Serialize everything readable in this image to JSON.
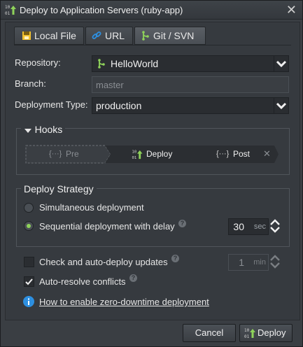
{
  "window": {
    "title": "Deploy to Application Servers (ruby-app)"
  },
  "tabs": [
    {
      "label": "Local File",
      "icon": "archive-icon"
    },
    {
      "label": "URL",
      "icon": "link-icon"
    },
    {
      "label": "Git / SVN",
      "icon": "git-icon",
      "active": true
    }
  ],
  "form": {
    "repository_label": "Repository:",
    "repository_value": "HelloWorld",
    "branch_label": "Branch:",
    "branch_value": "master",
    "deploy_type_label": "Deployment Type:",
    "deploy_type_value": "production"
  },
  "hooks": {
    "title": "Hooks",
    "pre": "Pre",
    "deploy": "Deploy",
    "post": "Post",
    "code_glyph": "{···}"
  },
  "strategy": {
    "title": "Deploy Strategy",
    "simultaneous": "Simultaneous deployment",
    "sequential": "Sequential deployment with delay",
    "selected": "sequential",
    "delay_value": "30",
    "delay_unit": "sec"
  },
  "options": {
    "auto_update_label": "Check and auto-deploy updates",
    "auto_update_checked": false,
    "interval_value": "1",
    "interval_unit": "min",
    "auto_resolve_label": "Auto-resolve conflicts",
    "auto_resolve_checked": true,
    "zero_downtime_link": "How to enable zero-downtime deployment"
  },
  "buttons": {
    "cancel": "Cancel",
    "deploy": "Deploy"
  },
  "colors": {
    "accent_green": "#8fd35a",
    "info_blue": "#2d8fe0",
    "link_blue": "#2d8fe0",
    "archive_yellow": "#f2c12e"
  }
}
